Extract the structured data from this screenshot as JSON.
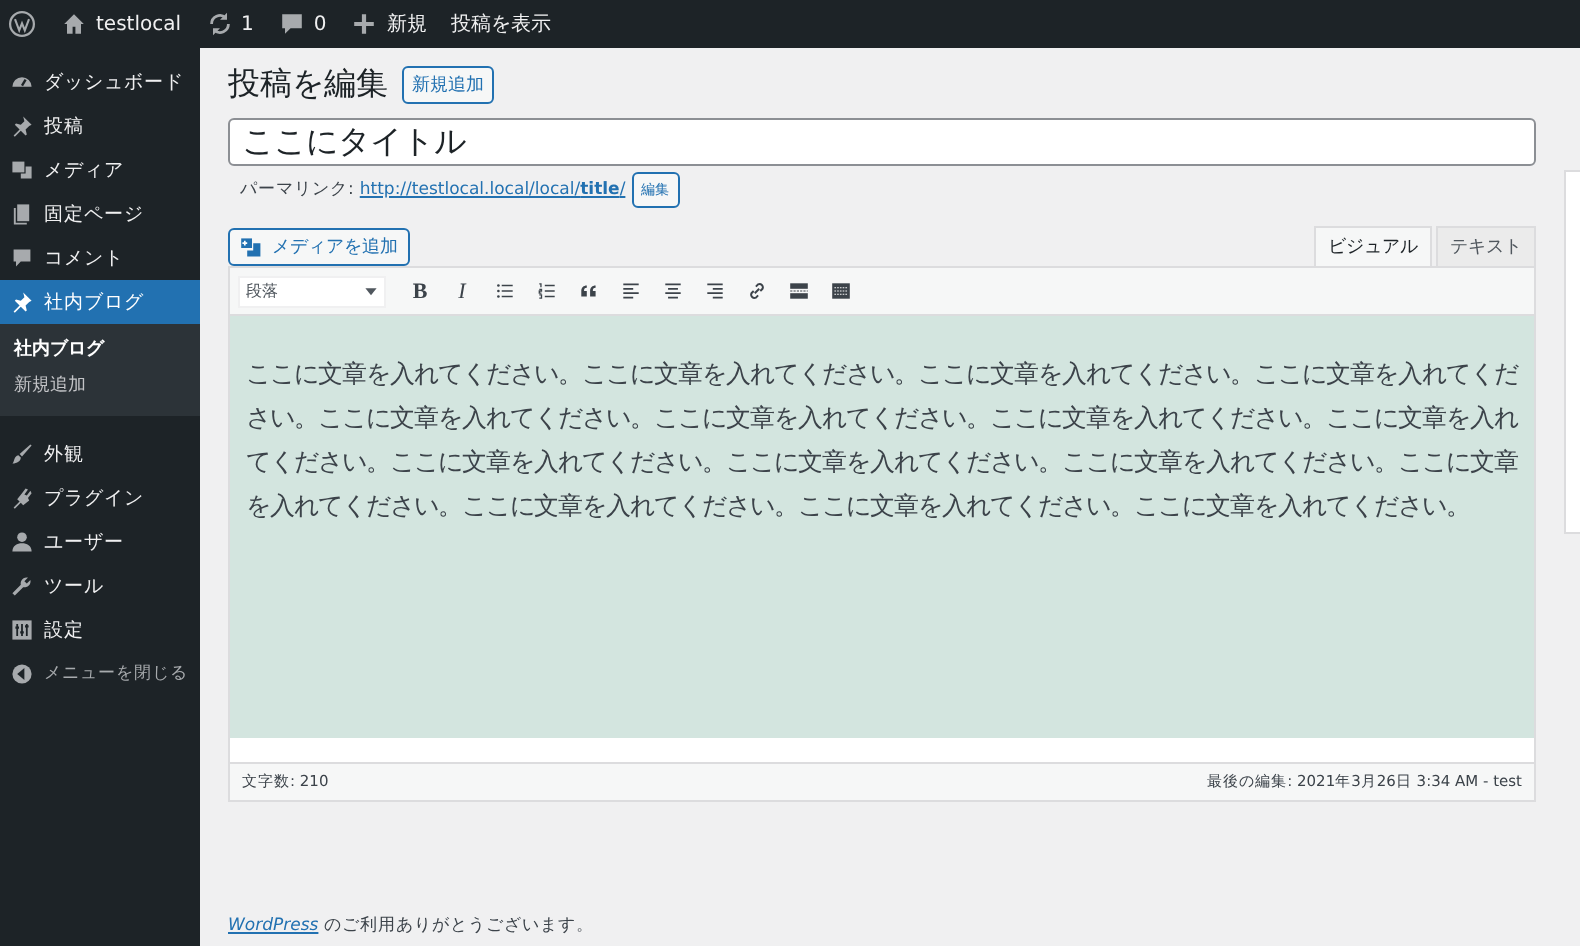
{
  "admin_bar": {
    "items": [
      {
        "kind": "wp"
      },
      {
        "kind": "home",
        "label": "testlocal"
      },
      {
        "kind": "update",
        "label": "1"
      },
      {
        "kind": "comment",
        "label": "0"
      },
      {
        "kind": "plus",
        "label": "新規"
      },
      {
        "kind": "text",
        "label": "投稿を表示"
      }
    ]
  },
  "sidebar": {
    "items": [
      {
        "kind": "dashboard",
        "label": "ダッシュボード",
        "selected": false
      },
      {
        "kind": "pin",
        "label": "投稿",
        "selected": false
      },
      {
        "kind": "media",
        "label": "メディア",
        "selected": false
      },
      {
        "kind": "page",
        "label": "固定ページ",
        "selected": false
      },
      {
        "kind": "comment",
        "label": "コメント",
        "selected": false
      },
      {
        "kind": "pin",
        "label": "社内ブログ",
        "selected": true,
        "children": [
          {
            "label": "社内ブログ",
            "selected": true
          },
          {
            "label": "新規追加",
            "selected": false
          }
        ]
      },
      {
        "kind": "brush",
        "label": "外観",
        "selected": false
      },
      {
        "kind": "plugin",
        "label": "プラグイン",
        "selected": false
      },
      {
        "kind": "user",
        "label": "ユーザー",
        "selected": false
      },
      {
        "kind": "wrench",
        "label": "ツール",
        "selected": false
      },
      {
        "kind": "settings",
        "label": "設定",
        "selected": false
      }
    ],
    "collapse": "メニューを閉じる"
  },
  "page": {
    "title": "投稿を編集",
    "add_new": "新規追加"
  },
  "post_title": {
    "value": "ここにタイトル"
  },
  "permalink": {
    "label": "パーマリンク:",
    "url": "http://testlocal.local/local/",
    "slug": "title",
    "trail": "/",
    "edit": "編集"
  },
  "add_media": "メディアを追加",
  "editor_tabs": [
    {
      "label": "ビジュアル",
      "selected": true
    },
    {
      "label": "テキスト",
      "selected": false
    }
  ],
  "toolbar": {
    "format": "段落",
    "buttons": [
      {
        "kind": "text",
        "label": "B"
      },
      {
        "kind": "text",
        "label": "I"
      },
      {
        "kind": "bullets"
      },
      {
        "kind": "numbers"
      },
      {
        "kind": "quote"
      },
      {
        "kind": "align-left"
      },
      {
        "kind": "align-center"
      },
      {
        "kind": "align-right"
      },
      {
        "kind": "link"
      },
      {
        "kind": "more"
      },
      {
        "kind": "toolbar"
      }
    ]
  },
  "content": "ここに文章を入れてください。ここに文章を入れてください。ここに文章を入れてください。ここに文章を入れてください。ここに文章を入れてください。ここに文章を入れてください。ここに文章を入れてください。ここに文章を入れてください。ここに文章を入れてください。ここに文章を入れてください。ここに文章を入れてください。ここに文章を入れてください。ここに文章を入れてください。ここに文章を入れてください。ここに文章を入れてください。",
  "status": {
    "word_count": "文字数: 210",
    "last_edit": "最後の編集: 2021年3月26日 3:34 AM - test"
  },
  "footer": {
    "link": "WordPress",
    "text": "のご利用ありがとうございます。"
  }
}
